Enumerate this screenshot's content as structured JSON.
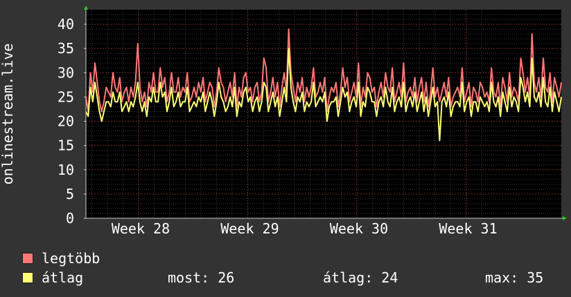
{
  "chart_data": {
    "type": "line",
    "ylabel": "onlinestream.live",
    "ylim": [
      0,
      43
    ],
    "yticks": [
      "0",
      "5",
      "10",
      "15",
      "20",
      "25",
      "30",
      "35",
      "40"
    ],
    "xticks": [
      "Week 28",
      "Week 29",
      "Week 30",
      "Week 31"
    ],
    "grid": true,
    "series": [
      {
        "name": "legtöbb",
        "color": "#ff7777",
        "values": [
          25,
          22,
          30,
          26,
          32,
          28,
          24,
          22,
          24,
          27,
          26,
          25,
          30,
          27,
          26,
          29,
          24,
          26,
          27,
          24,
          27,
          25,
          28,
          36,
          27,
          24,
          26,
          23,
          28,
          26,
          30,
          26,
          26,
          31,
          27,
          29,
          24,
          26,
          30,
          26,
          26,
          29,
          25,
          27,
          26,
          30,
          24,
          25,
          27,
          25,
          28,
          26,
          29,
          24,
          26,
          28,
          27,
          23,
          26,
          31,
          28,
          27,
          24,
          26,
          28,
          25,
          30,
          23,
          27,
          25,
          29,
          30,
          26,
          27,
          24,
          27,
          28,
          24,
          26,
          33,
          31,
          24,
          26,
          29,
          25,
          28,
          23,
          27,
          30,
          26,
          39,
          30,
          27,
          24,
          28,
          26,
          29,
          24,
          27,
          25,
          27,
          31,
          25,
          26,
          28,
          26,
          29,
          22,
          25,
          27,
          26,
          28,
          23,
          26,
          31,
          27,
          29,
          24,
          26,
          28,
          25,
          32,
          23,
          27,
          25,
          30,
          29,
          26,
          27,
          23,
          26,
          28,
          25,
          30,
          27,
          26,
          31,
          24,
          26,
          28,
          25,
          32,
          24,
          26,
          27,
          25,
          29,
          24,
          27,
          29,
          24,
          28,
          23,
          26,
          31,
          25,
          27,
          24,
          26,
          28,
          25,
          29,
          23,
          25,
          26,
          27,
          25,
          31,
          24,
          26,
          28,
          23,
          27,
          26,
          24,
          28,
          27,
          25,
          26,
          24,
          31,
          26,
          25,
          28,
          23,
          29,
          27,
          24,
          30,
          25,
          27,
          26,
          24,
          33,
          30,
          26,
          29,
          25,
          38,
          28,
          26,
          29,
          25,
          33,
          27,
          26,
          30,
          24,
          29,
          27,
          25,
          28
        ]
      },
      {
        "name": "átlag",
        "color": "#ffff77",
        "values": [
          22,
          21,
          27,
          24,
          28,
          25,
          22,
          20,
          22,
          24,
          24,
          23,
          26,
          24,
          24,
          26,
          22,
          23,
          24,
          22,
          24,
          23,
          25,
          28,
          24,
          22,
          24,
          21,
          25,
          24,
          27,
          24,
          24,
          28,
          25,
          26,
          22,
          24,
          27,
          23,
          24,
          26,
          23,
          24,
          24,
          27,
          22,
          23,
          24,
          23,
          25,
          24,
          26,
          22,
          24,
          26,
          24,
          21,
          24,
          28,
          25,
          24,
          22,
          23,
          25,
          23,
          27,
          21,
          24,
          23,
          26,
          27,
          24,
          25,
          22,
          24,
          25,
          22,
          24,
          28,
          27,
          22,
          24,
          26,
          23,
          25,
          21,
          24,
          27,
          24,
          35,
          27,
          24,
          22,
          25,
          24,
          26,
          22,
          24,
          23,
          24,
          28,
          23,
          24,
          25,
          24,
          26,
          20,
          23,
          24,
          24,
          25,
          21,
          24,
          27,
          25,
          26,
          22,
          24,
          25,
          23,
          28,
          21,
          24,
          23,
          27,
          26,
          24,
          24,
          21,
          24,
          25,
          23,
          27,
          24,
          23,
          27,
          22,
          24,
          25,
          23,
          28,
          22,
          24,
          25,
          23,
          26,
          22,
          24,
          26,
          22,
          25,
          21,
          24,
          27,
          23,
          24,
          16,
          24,
          25,
          23,
          26,
          21,
          23,
          24,
          24,
          23,
          28,
          22,
          24,
          25,
          21,
          24,
          24,
          22,
          25,
          24,
          23,
          24,
          22,
          28,
          24,
          23,
          25,
          21,
          26,
          24,
          22,
          27,
          23,
          25,
          24,
          22,
          29,
          27,
          24,
          26,
          23,
          33,
          25,
          24,
          26,
          23,
          29,
          24,
          23,
          27,
          22,
          26,
          24,
          22,
          25
        ]
      }
    ]
  },
  "legend": [
    {
      "label": "legtöbb",
      "color": "#ff7777"
    },
    {
      "label": "átlag",
      "color": "#ffff77"
    }
  ],
  "stats": {
    "now": "most: 26",
    "avg": "átlag: 24",
    "max": "max: 35"
  }
}
